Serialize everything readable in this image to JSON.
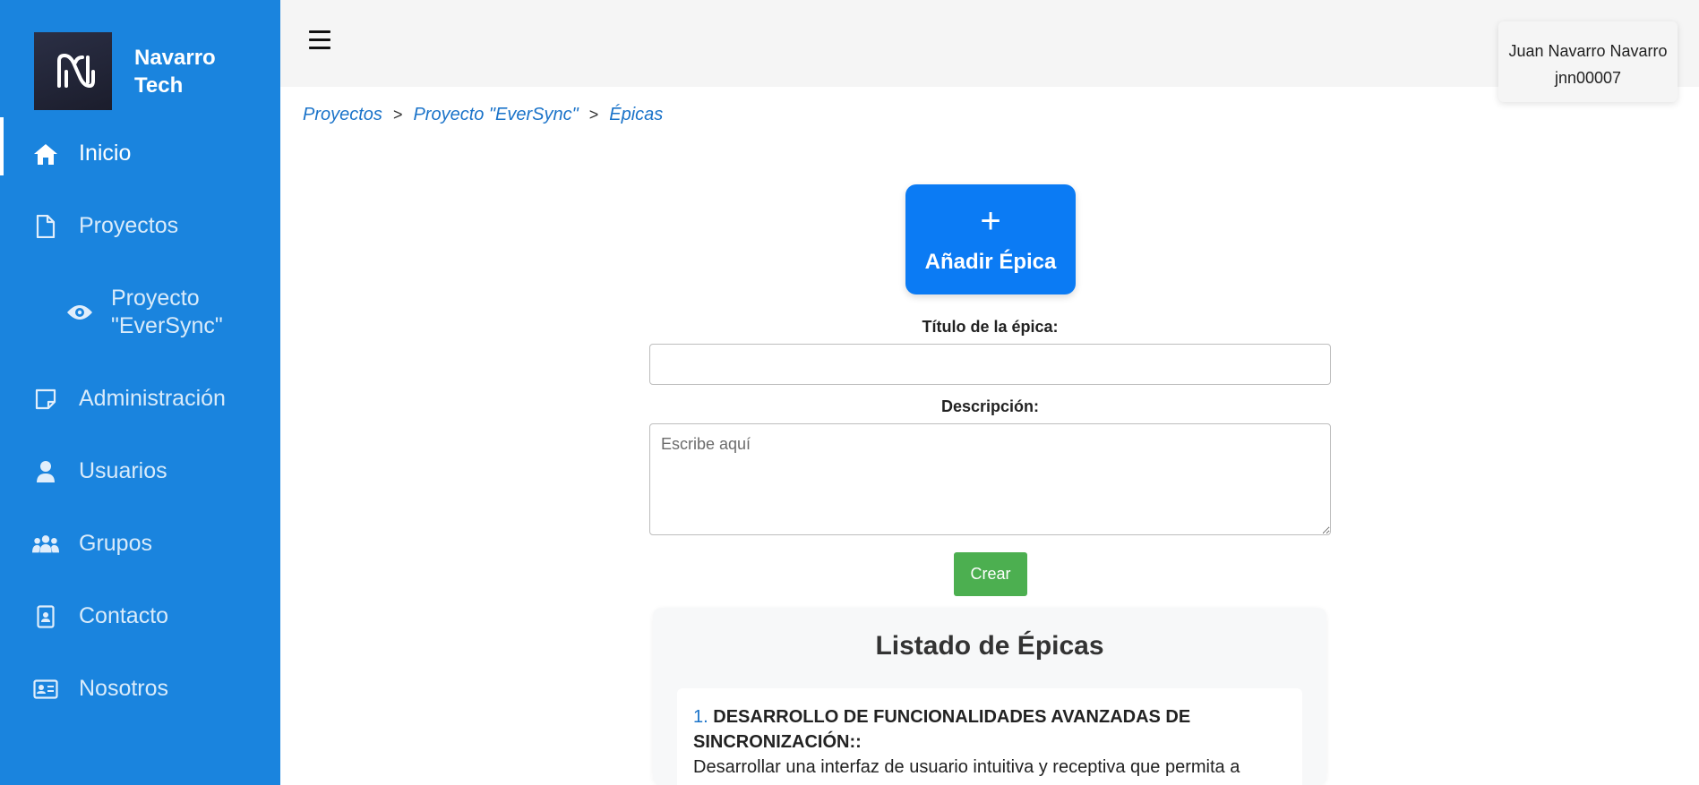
{
  "brand": {
    "name": "Navarro Tech"
  },
  "sidebar": {
    "items": [
      {
        "label": "Inicio",
        "icon": "home-icon",
        "active": true
      },
      {
        "label": "Proyectos",
        "icon": "file-icon"
      },
      {
        "label": "Proyecto \"EverSync\"",
        "icon": "eye-icon",
        "sub": true
      },
      {
        "label": "Administración",
        "icon": "note-icon"
      },
      {
        "label": "Usuarios",
        "icon": "user-icon"
      },
      {
        "label": "Grupos",
        "icon": "users-icon"
      },
      {
        "label": "Contacto",
        "icon": "contact-badge-icon"
      },
      {
        "label": "Nosotros",
        "icon": "id-card-icon"
      }
    ]
  },
  "user": {
    "name": "Juan Navarro Navarro",
    "username": "jnn00007"
  },
  "breadcrumb": [
    "Proyectos",
    "Proyecto \"EverSync\"",
    "Épicas"
  ],
  "breadcrumb_separator": ">",
  "add_button": {
    "plus": "+",
    "label": "Añadir Épica"
  },
  "form": {
    "title_label": "Título de la épica:",
    "title_value": "",
    "description_label": "Descripción:",
    "description_placeholder": "Escribe aquí",
    "submit_label": "Crear"
  },
  "list": {
    "title": "Listado de Épicas",
    "items": [
      {
        "number": "1.",
        "title": "DESARROLLO DE FUNCIONALIDADES AVANZADAS DE SINCRONIZACIÓN::",
        "description": "Desarrollar una interfaz de usuario intuitiva y receptiva que permita a"
      }
    ]
  },
  "colors": {
    "sidebar": "#1a84de",
    "primary_button": "#0b7bf4",
    "create_button": "#4caf50",
    "link": "#1a73c9"
  }
}
